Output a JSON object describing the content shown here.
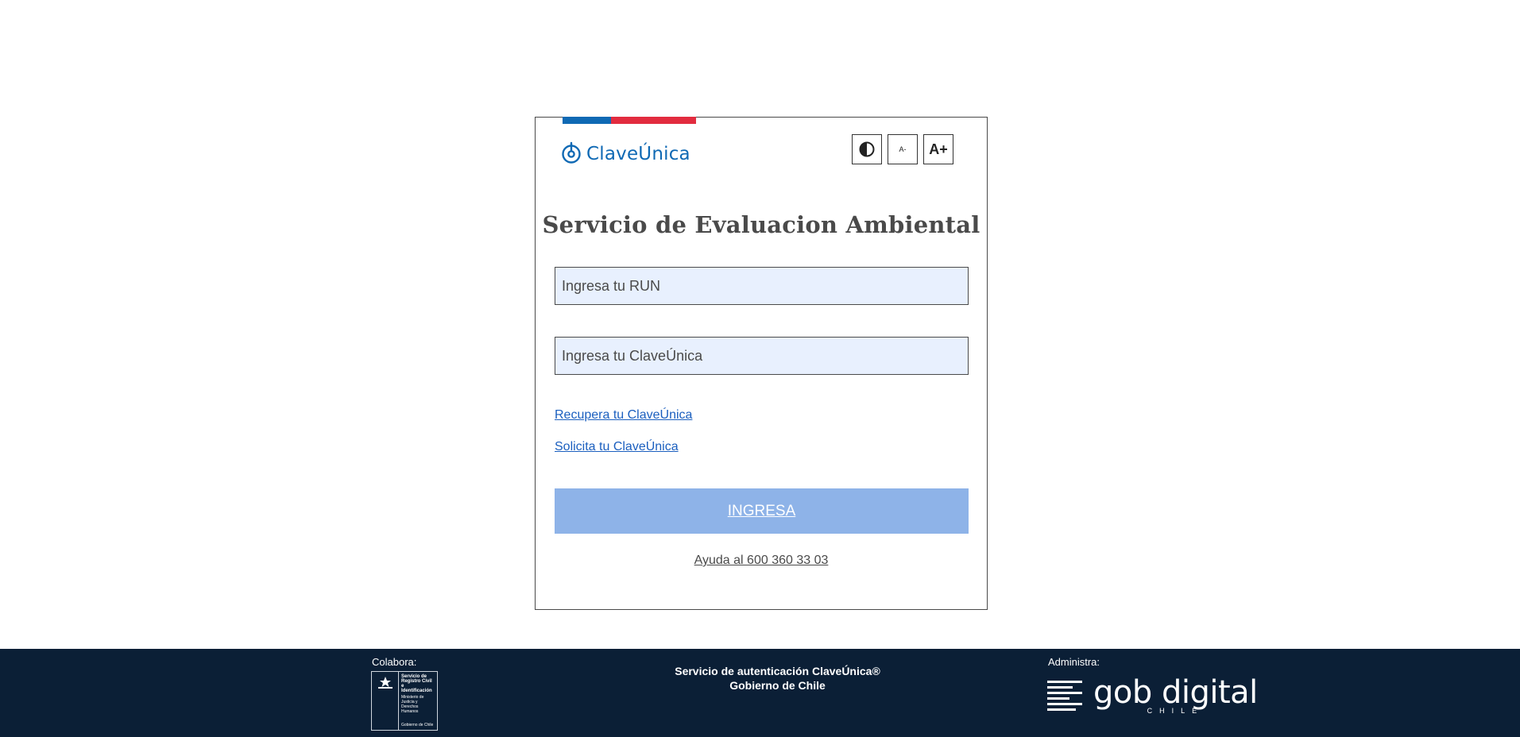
{
  "brand": {
    "logo_text": "ClaveÚnica",
    "flag_colors": [
      "#0f69b4",
      "#e22c3f"
    ]
  },
  "accessibility": {
    "contrast_icon": "contrast-icon",
    "decrease_label": "A-",
    "increase_label": "A+"
  },
  "login": {
    "title": "Servicio de Evaluacion Ambiental",
    "run_placeholder": "Ingresa tu RUN",
    "clave_placeholder": "Ingresa tu ClaveÚnica",
    "recover_link": "Recupera tu ClaveÚnica",
    "request_link": "Solicita tu ClaveÚnica",
    "submit_label": "INGRESA",
    "help_text": "Ayuda al 600 360 33 03",
    "accent_color": "#8eb3e8"
  },
  "footer": {
    "colabora_label": "Colabora:",
    "srci": {
      "line1": "Servicio de Registro Civil e Identificación",
      "line2": "Ministerio de Justicia y Derechos Humanos",
      "line3": "Gobierno de Chile"
    },
    "service_line1": "Servicio de autenticación ClaveÚnica®",
    "service_line2": "Gobierno de Chile",
    "administra_label": "Administra:",
    "gob_digital": "gob digital",
    "gob_digital_sub": "CHILE",
    "background": "#0b1f36"
  }
}
